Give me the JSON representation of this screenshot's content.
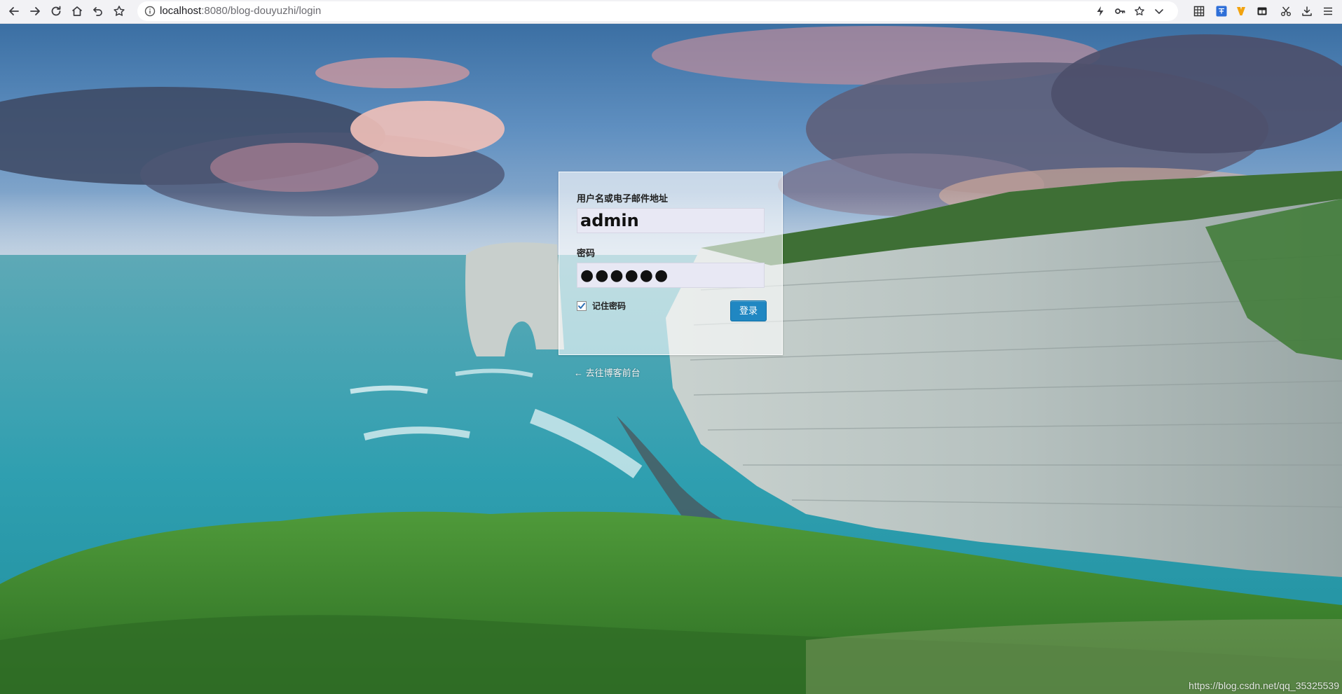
{
  "browser": {
    "url_host": "localhost",
    "url_path": ":8080/blog-douyuzhi/login"
  },
  "login": {
    "username_label": "用户名或电子邮件地址",
    "username_value": "admin",
    "password_label": "密码",
    "password_value": "●●●●●●",
    "remember_label": "记住密码",
    "remember_checked": true,
    "submit_label": "登录"
  },
  "back_link": "← 去往博客前台",
  "watermark": "https://blog.csdn.net/qq_35325539",
  "colors": {
    "login_button": "#2087c2",
    "sea": "#3aa7b3",
    "grass": "#3f8a2e",
    "sky": "#4a79a8"
  }
}
